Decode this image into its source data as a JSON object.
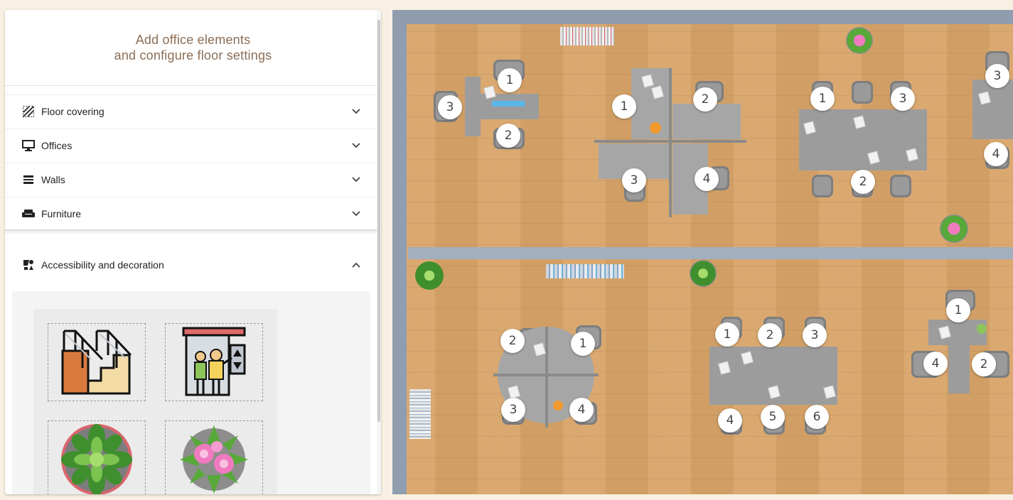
{
  "sidebar": {
    "header": {
      "line1": "Add office elements",
      "line2": "and configure floor settings"
    },
    "sections": [
      {
        "label": "Floor covering",
        "icon": "hatch-icon",
        "expanded": false
      },
      {
        "label": "Offices",
        "icon": "monitor-icon",
        "expanded": false
      },
      {
        "label": "Walls",
        "icon": "wall-icon",
        "expanded": false
      },
      {
        "label": "Furniture",
        "icon": "sofa-icon",
        "expanded": false
      },
      {
        "label": "Accessibility and decoration",
        "icon": "accessibility-icon",
        "expanded": true
      }
    ],
    "decoration_items": [
      "stairs-icon",
      "elevator-icon",
      "green-plant-icon",
      "pink-flower-plant-icon"
    ]
  },
  "floor": {
    "seats": {
      "desk_a": [
        "1",
        "2",
        "3"
      ],
      "desk_b": [
        "1",
        "2",
        "3",
        "4"
      ],
      "desk_c": [
        "1",
        "2",
        "3"
      ],
      "desk_d": [
        "3",
        "4"
      ],
      "desk_e": [
        "1",
        "2",
        "3",
        "4"
      ],
      "desk_f": [
        "1",
        "2",
        "3",
        "4",
        "5",
        "6"
      ],
      "desk_g": [
        "1",
        "2",
        "4"
      ]
    }
  }
}
